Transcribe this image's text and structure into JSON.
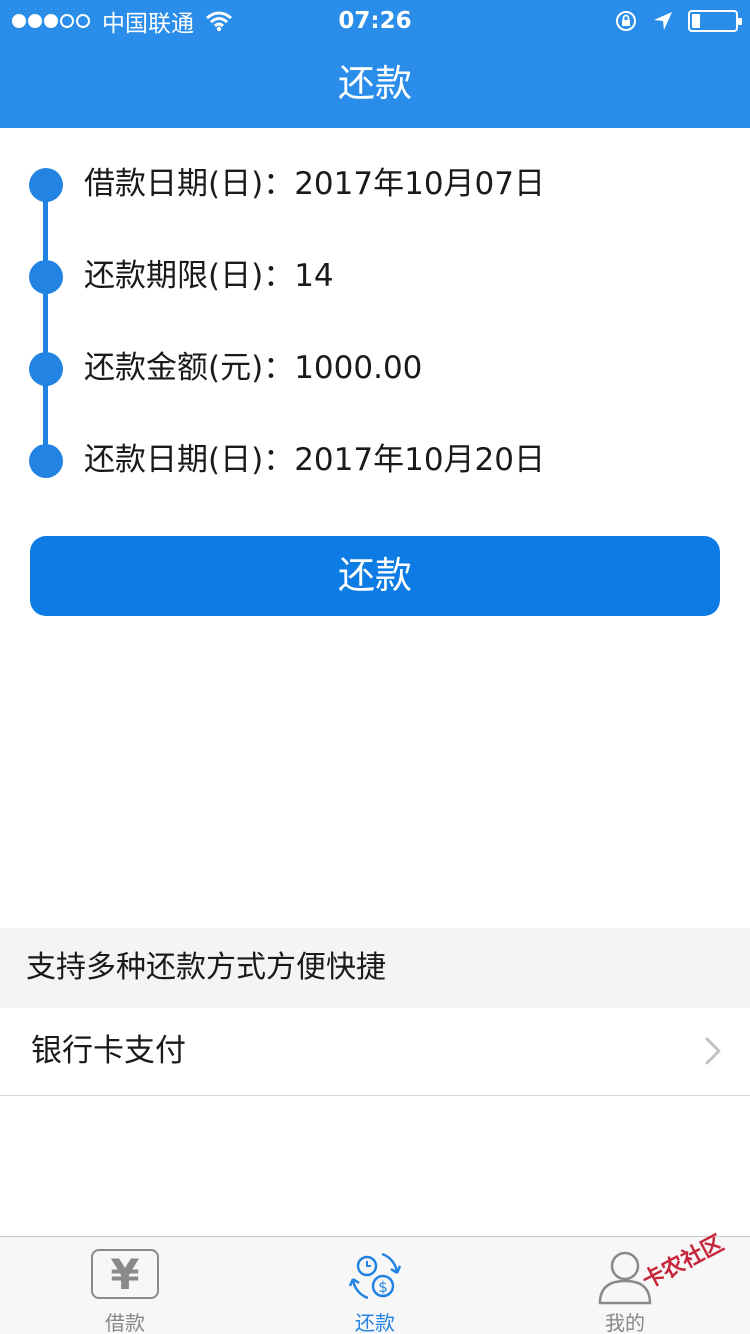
{
  "status_bar": {
    "carrier": "中国联通",
    "time": "07:26",
    "signal_filled": 3,
    "signal_total": 5,
    "battery_level": 0.2
  },
  "nav": {
    "title": "还款"
  },
  "timeline": {
    "items": [
      {
        "label": "借款日期(日)：",
        "value": "2017年10月07日"
      },
      {
        "label": "还款期限(日)：",
        "value": "14"
      },
      {
        "label": "还款金额(元)：",
        "value": "1000.00"
      },
      {
        "label": "还款日期(日)：",
        "value": "2017年10月20日"
      }
    ]
  },
  "repay_button": {
    "label": "还款"
  },
  "methods": {
    "header": "支持多种还款方式方便快捷",
    "items": [
      {
        "label": "银行卡支付"
      }
    ]
  },
  "tabbar": {
    "tabs": [
      {
        "label": "借款",
        "icon": "yen-icon"
      },
      {
        "label": "还款",
        "icon": "repay-cycle-icon"
      },
      {
        "label": "我的",
        "icon": "user-icon"
      }
    ],
    "active": "还款"
  },
  "watermark": {
    "text": "卡农社区"
  },
  "colors": {
    "header": "#2a8de9",
    "accent": "#2383e2",
    "button": "#0c7ce4"
  }
}
